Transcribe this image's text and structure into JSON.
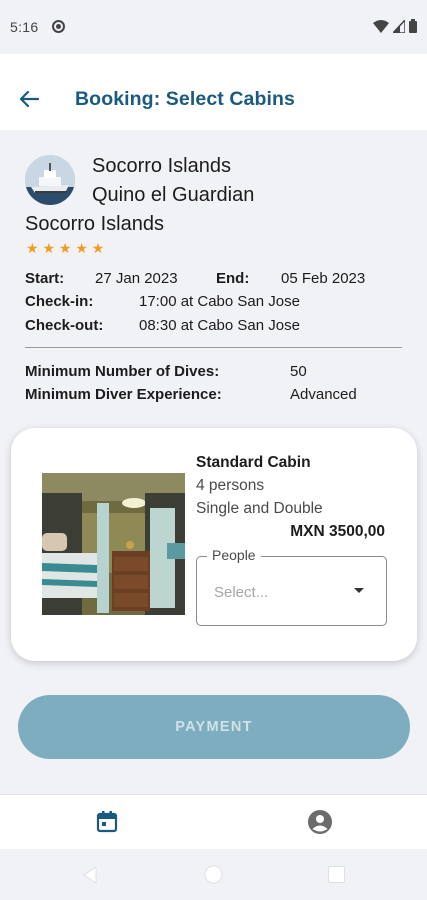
{
  "status": {
    "time": "5:16"
  },
  "app_bar": {
    "title": "Booking: Select Cabins"
  },
  "trip": {
    "name_line1": "Socorro Islands",
    "name_line2": "Quino el Guardian",
    "destination": "Socorro Islands",
    "rating": 5,
    "stars": "★ ★ ★ ★ ★",
    "start_label": "Start:",
    "start_value": "27 Jan 2023",
    "end_label": "End:",
    "end_value": "05 Feb 2023",
    "checkin_label": "Check-in:",
    "checkin_value": "17:00 at Cabo San Jose",
    "checkout_label": "Check-out:",
    "checkout_value": "08:30 at Cabo San Jose",
    "min_dives_label": "Minimum Number of Dives:",
    "min_dives_value": "50",
    "min_exp_label": "Minimum Diver Experience:",
    "min_exp_value": "Advanced"
  },
  "cabin": {
    "title": "Standard Cabin",
    "persons": "4 persons",
    "beds": "Single and Double",
    "price": "MXN 3500,00",
    "people_label": "People",
    "people_placeholder": "Select..."
  },
  "payment_button": "PAYMENT",
  "colors": {
    "accent": "#1b5a80",
    "star": "#f59a1c",
    "payment_disabled": "#7fadc0"
  },
  "bottom_nav": {
    "items": [
      {
        "icon": "calendar-icon",
        "active": true
      },
      {
        "icon": "account-circle-icon",
        "active": false
      }
    ]
  }
}
